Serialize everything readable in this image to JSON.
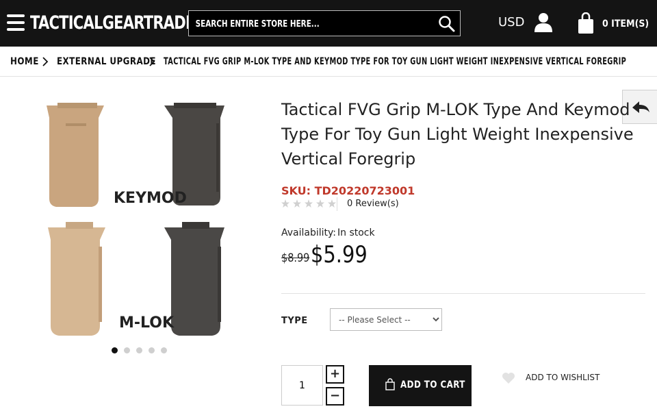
{
  "header": {
    "logo": "TACTICALGEARTRADE",
    "search_placeholder": "SEARCH ENTIRE STORE HERE...",
    "currency": "USD",
    "cart": "0 ITEM(S)"
  },
  "breadcrumb": [
    "HOME",
    "EXTERNAL UPGRADE",
    "TACTICAL FVG GRIP M-LOK TYPE AND KEYMOD TYPE FOR TOY GUN LIGHT WEIGHT INEXPENSIVE VERTICAL FOREGRIP"
  ],
  "gallery": {
    "label_keymod": "KEYMOD",
    "label_mlok": "M-LOK",
    "slide_count": 5,
    "active_slide": 1
  },
  "product": {
    "title": "Tactical FVG Grip M-LOK Type And Keymod Type For Toy Gun Light Weight Inexpensive Vertical Foregrip",
    "sku": "SKU: TD20220723001",
    "rating": 0,
    "reviews": "0 Review(s)",
    "availability_label": "Availability:",
    "availability_value": "In stock",
    "old_price": "$8.99",
    "new_price": "$5.99",
    "type_label": "TYPE",
    "type_selected": "-- Please Select --",
    "quantity": "1",
    "plus": "+",
    "minus": "−",
    "add_to_cart": "ADD TO CART",
    "wishlist": "ADD TO WISHLIST"
  },
  "colors": {
    "header_bg": "#141414",
    "sku_red": "#c0392b",
    "tan": "#c9a57f",
    "dark_grip": "#4a4744"
  }
}
